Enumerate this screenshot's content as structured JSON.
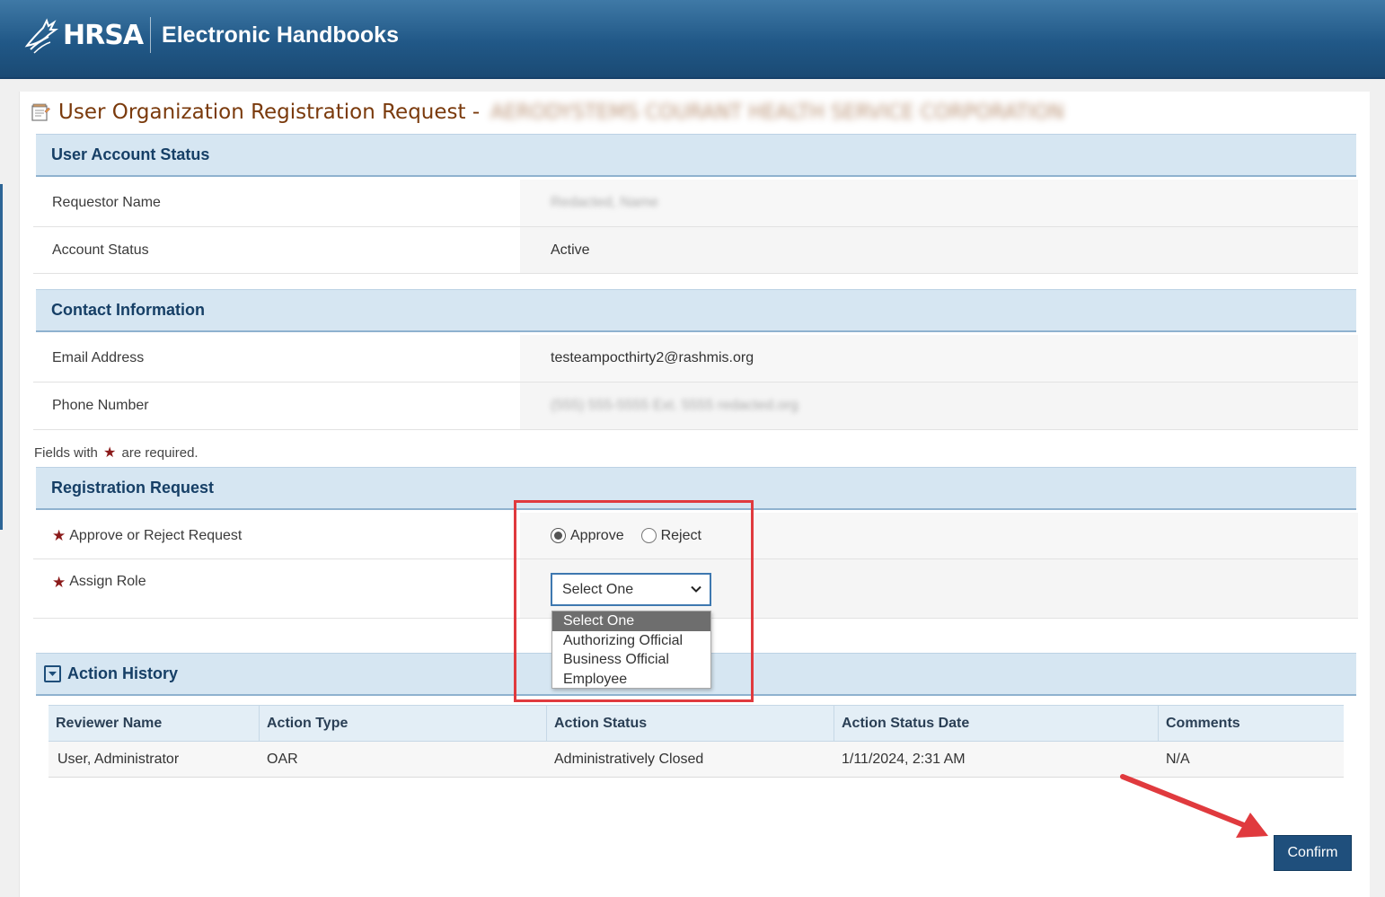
{
  "header": {
    "logo_text": "HRSA",
    "app_title": "Electronic Handbooks"
  },
  "page": {
    "title": "User Organization Registration Request -",
    "title_suffix_redacted": "AERODYSTEMS COURANT HEALTH SERVICE CORPORATION"
  },
  "user_account_status": {
    "heading": "User Account Status",
    "requestor_label": "Requestor Name",
    "requestor_value": "Redacted, Name",
    "account_status_label": "Account Status",
    "account_status_value": "Active"
  },
  "contact_information": {
    "heading": "Contact Information",
    "email_label": "Email Address",
    "email_value": "testeampocthirty2@rashmis.org",
    "phone_label": "Phone Number",
    "phone_value": "(555) 555-5555 Ext. 5555 redacted.org"
  },
  "required_note": {
    "prefix": "Fields with",
    "suffix": "are required."
  },
  "registration_request": {
    "heading": "Registration Request",
    "approve_reject_label": "Approve or Reject Request",
    "approve_label": "Approve",
    "reject_label": "Reject",
    "selected_decision": "Approve",
    "assign_role_label": "Assign Role",
    "assign_role_value": "Select One",
    "role_options": [
      "Select One",
      "Authorizing Official",
      "Business Official",
      "Employee"
    ]
  },
  "action_history": {
    "heading": "Action History",
    "columns": [
      "Reviewer Name",
      "Action Type",
      "Action Status",
      "Action Status Date",
      "Comments"
    ],
    "rows": [
      [
        "User, Administrator",
        "OAR",
        "Administratively Closed",
        "1/11/2024, 2:31 AM",
        "N/A"
      ]
    ]
  },
  "footer": {
    "confirm_label": "Confirm"
  },
  "colors": {
    "header_blue": "#215887",
    "section_bg": "#d6e6f2",
    "title_brown": "#7a3a0c",
    "required_star": "#8b1a1a",
    "highlight_red": "#e03a3e",
    "confirm_bg": "#1f4f7c"
  }
}
